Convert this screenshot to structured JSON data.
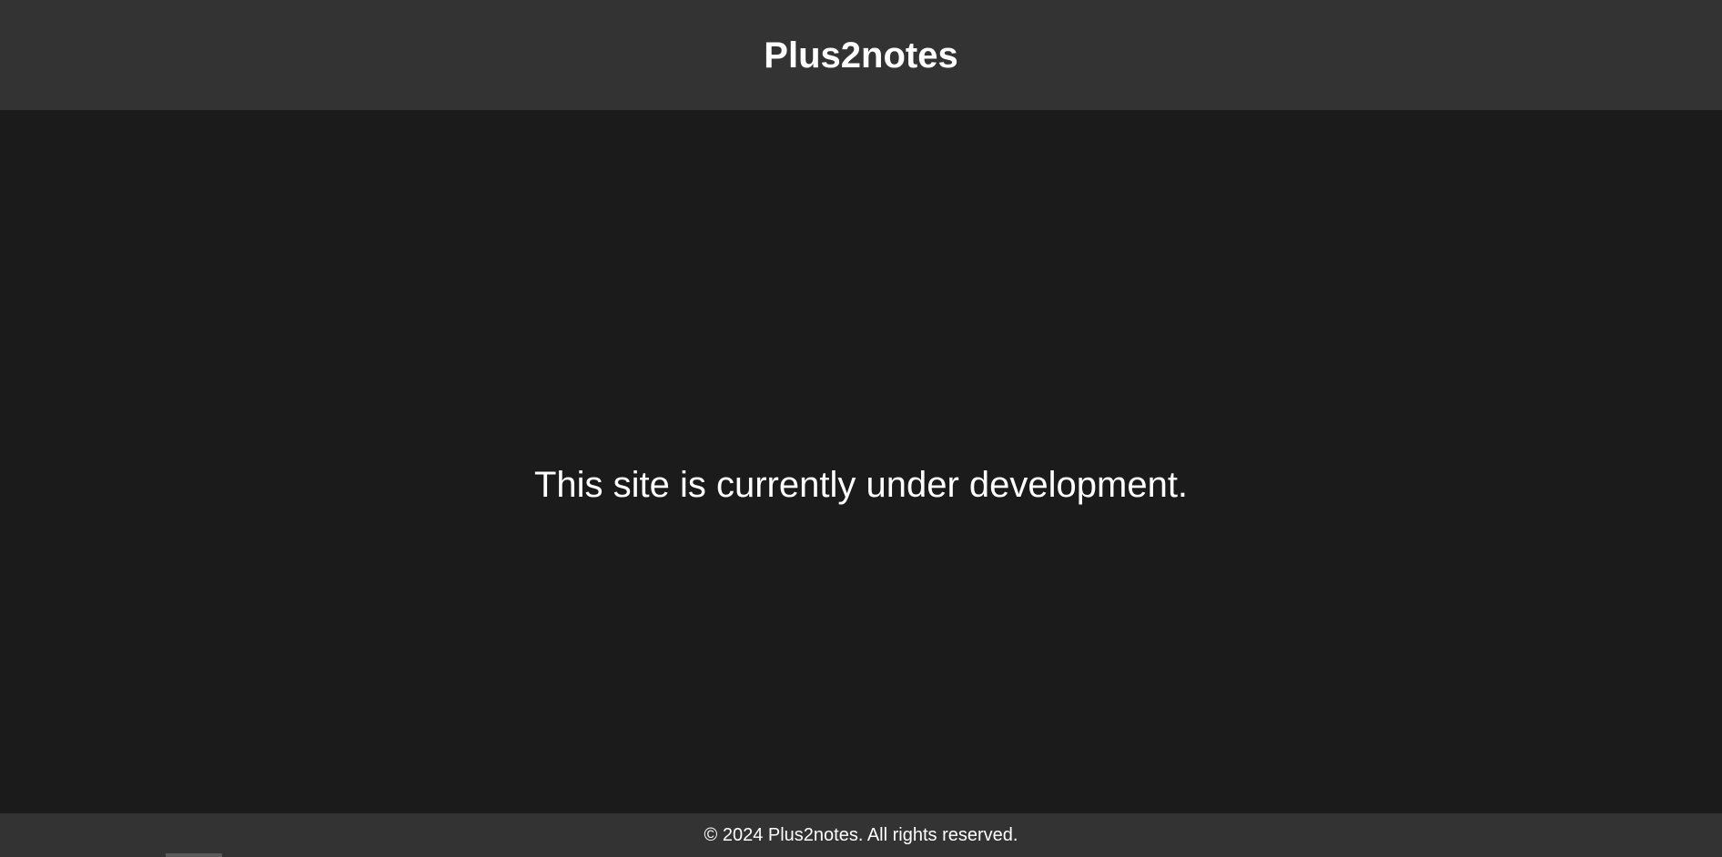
{
  "header": {
    "title": "Plus2notes"
  },
  "main": {
    "message": "This site is currently under development."
  },
  "footer": {
    "text": "© 2024 Plus2notes. All rights reserved."
  },
  "colors": {
    "header_bg": "#333333",
    "body_bg": "#1b1b1b",
    "footer_bg": "#333333",
    "text": "#ffffff"
  }
}
